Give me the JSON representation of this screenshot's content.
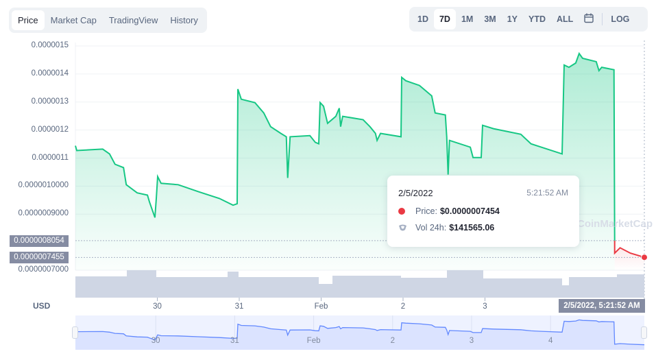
{
  "tabs": [
    {
      "label": "Price",
      "active": true
    },
    {
      "label": "Market Cap"
    },
    {
      "label": "TradingView"
    },
    {
      "label": "History"
    }
  ],
  "ranges": [
    {
      "label": "1D"
    },
    {
      "label": "7D",
      "active": true
    },
    {
      "label": "1M"
    },
    {
      "label": "3M"
    },
    {
      "label": "1Y"
    },
    {
      "label": "YTD"
    },
    {
      "label": "ALL"
    }
  ],
  "calendar_icon": "calendar-icon",
  "log_label": "LOG",
  "currency": "USD",
  "watermark": "CoinMarketCap",
  "colors": {
    "up": "#16c784",
    "down": "#ea3943",
    "volume": "#cfd6e4",
    "navigator": "#6188ff"
  },
  "tooltip": {
    "date": "2/5/2022",
    "time": "5:21:52 AM",
    "price_label": "Price:",
    "price_value": "$0.0000007454",
    "vol_label": "Vol 24h:",
    "vol_value": "$141565.06"
  },
  "crosshair_label": "2/5/2022, 5:21:52 AM",
  "chart_data": {
    "type": "area",
    "ylim": [
      7e-07,
      1.5e-06
    ],
    "y_ticks": [
      "0.0000015",
      "0.0000014",
      "0.0000013",
      "0.0000012",
      "0.0000011",
      "0.0000010000",
      "0.0000009000",
      "0.0000007000"
    ],
    "y_tick_values": [
      1.5e-06,
      1.4e-06,
      1.3e-06,
      1.2e-06,
      1.1e-06,
      1e-06,
      9e-07,
      7e-07
    ],
    "highlight_labels": [
      {
        "label": "0.0000008054",
        "value": 8.054e-07
      },
      {
        "label": "0.0000007455",
        "value": 7.455e-07
      }
    ],
    "x_ticks": [
      {
        "label": "30",
        "at": "2022-01-30T00:00"
      },
      {
        "label": "31",
        "at": "2022-01-31T00:00"
      },
      {
        "label": "Feb",
        "at": "2022-02-01T00:00"
      },
      {
        "label": "2",
        "at": "2022-02-02T00:00"
      },
      {
        "label": "3",
        "at": "2022-02-03T00:00"
      }
    ],
    "navigator_ticks": [
      {
        "label": "30",
        "at": "2022-01-30T00:00"
      },
      {
        "label": "31",
        "at": "2022-01-31T00:00"
      },
      {
        "label": "Feb",
        "at": "2022-02-01T00:00"
      },
      {
        "label": "2",
        "at": "2022-02-02T00:00"
      },
      {
        "label": "3",
        "at": "2022-02-03T00:00"
      },
      {
        "label": "4",
        "at": "2022-02-04T00:00"
      }
    ],
    "xlim": [
      "2022-01-29T00:00",
      "2022-02-04T22:42"
    ],
    "grid": true,
    "series": [
      {
        "points": [
          [
            "2022-01-29T00:00",
            1.144e-06
          ],
          [
            "2022-01-29T00:24",
            1.127e-06
          ],
          [
            "2022-01-29T08:00",
            1.132e-06
          ],
          [
            "2022-01-29T10:00",
            1.115e-06
          ],
          [
            "2022-01-29T11:36",
            1.078e-06
          ],
          [
            "2022-01-29T14:06",
            1.066e-06
          ],
          [
            "2022-01-29T14:54",
            1.005e-06
          ],
          [
            "2022-01-29T18:06",
            9.76e-07
          ],
          [
            "2022-01-29T21:06",
            9.68e-07
          ],
          [
            "2022-01-29T21:42",
            9.44e-07
          ],
          [
            "2022-01-29T23:18",
            8.88e-07
          ],
          [
            "2022-01-29T23:42",
            9.56e-07
          ],
          [
            "2022-01-30T00:06",
            1.034e-06
          ],
          [
            "2022-01-30T01:06",
            1.01e-06
          ],
          [
            "2022-01-30T06:06",
            1.005e-06
          ],
          [
            "2022-01-30T12:06",
            9.8e-07
          ],
          [
            "2022-01-30T18:12",
            9.56e-07
          ],
          [
            "2022-01-30T22:12",
            9.32e-07
          ],
          [
            "2022-01-30T23:24",
            9.37e-07
          ],
          [
            "2022-01-30T23:36",
            1.346e-06
          ],
          [
            "2022-01-31T00:36",
            1.31e-06
          ],
          [
            "2022-01-31T04:36",
            1.298e-06
          ],
          [
            "2022-01-31T07:12",
            1.261e-06
          ],
          [
            "2022-01-31T09:12",
            1.212e-06
          ],
          [
            "2022-01-31T12:12",
            1.188e-06
          ],
          [
            "2022-01-31T13:48",
            1.176e-06
          ],
          [
            "2022-01-31T14:12",
            1.029e-06
          ],
          [
            "2022-01-31T14:54",
            1.176e-06
          ],
          [
            "2022-01-31T20:42",
            1.18e-06
          ],
          [
            "2022-01-31T22:18",
            1.156e-06
          ],
          [
            "2022-01-31T23:18",
            1.151e-06
          ],
          [
            "2022-01-31T23:42",
            1.298e-06
          ],
          [
            "2022-02-01T00:42",
            1.285e-06
          ],
          [
            "2022-02-01T01:54",
            1.224e-06
          ],
          [
            "2022-02-01T04:18",
            1.249e-06
          ],
          [
            "2022-02-01T05:18",
            1.278e-06
          ],
          [
            "2022-02-01T05:42",
            1.212e-06
          ],
          [
            "2022-02-01T06:18",
            1.249e-06
          ],
          [
            "2022-02-01T12:18",
            1.237e-06
          ],
          [
            "2022-02-01T14:18",
            1.212e-06
          ],
          [
            "2022-02-01T15:54",
            1.188e-06
          ],
          [
            "2022-02-01T16:24",
            1.163e-06
          ],
          [
            "2022-02-01T17:24",
            1.188e-06
          ],
          [
            "2022-02-01T23:24",
            1.176e-06
          ],
          [
            "2022-02-01T23:36",
            1.388e-06
          ],
          [
            "2022-02-02T00:48",
            1.376e-06
          ],
          [
            "2022-02-02T04:48",
            1.359e-06
          ],
          [
            "2022-02-02T08:24",
            1.322e-06
          ],
          [
            "2022-02-02T09:24",
            1.261e-06
          ],
          [
            "2022-02-02T12:24",
            1.254e-06
          ],
          [
            "2022-02-02T12:48",
            1.176e-06
          ],
          [
            "2022-02-02T13:12",
            1.041e-06
          ],
          [
            "2022-02-02T13:36",
            1.163e-06
          ],
          [
            "2022-02-02T19:42",
            1.139e-06
          ],
          [
            "2022-02-02T20:30",
            1.102e-06
          ],
          [
            "2022-02-02T22:54",
            1.102e-06
          ],
          [
            "2022-02-02T23:18",
            1.217e-06
          ],
          [
            "2022-02-03T02:30",
            1.205e-06
          ],
          [
            "2022-02-03T10:30",
            1.185e-06
          ],
          [
            "2022-02-03T13:30",
            1.151e-06
          ],
          [
            "2022-02-03T16:30",
            1.139e-06
          ],
          [
            "2022-02-03T22:36",
            1.115e-06
          ],
          [
            "2022-02-03T23:12",
            1.432e-06
          ],
          [
            "2022-02-04T00:36",
            1.424e-06
          ],
          [
            "2022-02-04T02:36",
            1.439e-06
          ],
          [
            "2022-02-04T03:36",
            1.473e-06
          ],
          [
            "2022-02-04T04:36",
            1.456e-06
          ],
          [
            "2022-02-04T08:36",
            1.444e-06
          ],
          [
            "2022-02-04T09:24",
            1.412e-06
          ],
          [
            "2022-02-04T10:12",
            1.424e-06
          ],
          [
            "2022-02-04T13:48",
            1.415e-06
          ],
          [
            "2022-02-04T14:00",
            7.61e-07
          ],
          [
            "2022-02-04T15:36",
            7.8e-07
          ],
          [
            "2022-02-04T18:36",
            7.61e-07
          ],
          [
            "2022-02-04T22:42",
            7.46e-07
          ]
        ]
      }
    ]
  }
}
